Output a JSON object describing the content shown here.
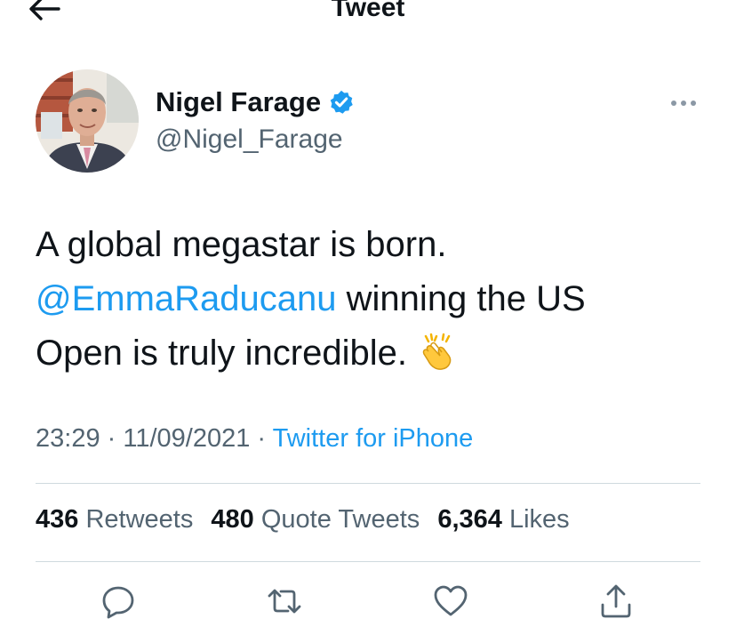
{
  "header": {
    "title": "Tweet"
  },
  "author": {
    "name": "Nigel Farage",
    "handle": "@Nigel_Farage"
  },
  "tweet": {
    "line1": "A global megastar is born.",
    "mention": "@EmmaRaducanu",
    "line2_rest": " winning the US",
    "line3": "Open is truly incredible. ",
    "emoji": "clapping-hands-emoji"
  },
  "meta": {
    "time": "23:29",
    "separator": " · ",
    "date": "11/09/2021",
    "source": "Twitter for iPhone"
  },
  "stats": {
    "retweets_count": "436",
    "retweets_label": "Retweets",
    "quotes_count": "480",
    "quotes_label": "Quote Tweets",
    "likes_count": "6,364",
    "likes_label": "Likes"
  },
  "colors": {
    "accent": "#1d9bf0",
    "secondary_text": "#536471",
    "divider": "#cfd9de"
  },
  "icons": [
    "back-arrow-icon",
    "verified-badge-icon",
    "more-icon",
    "reply-icon",
    "retweet-icon",
    "like-icon",
    "share-icon"
  ]
}
